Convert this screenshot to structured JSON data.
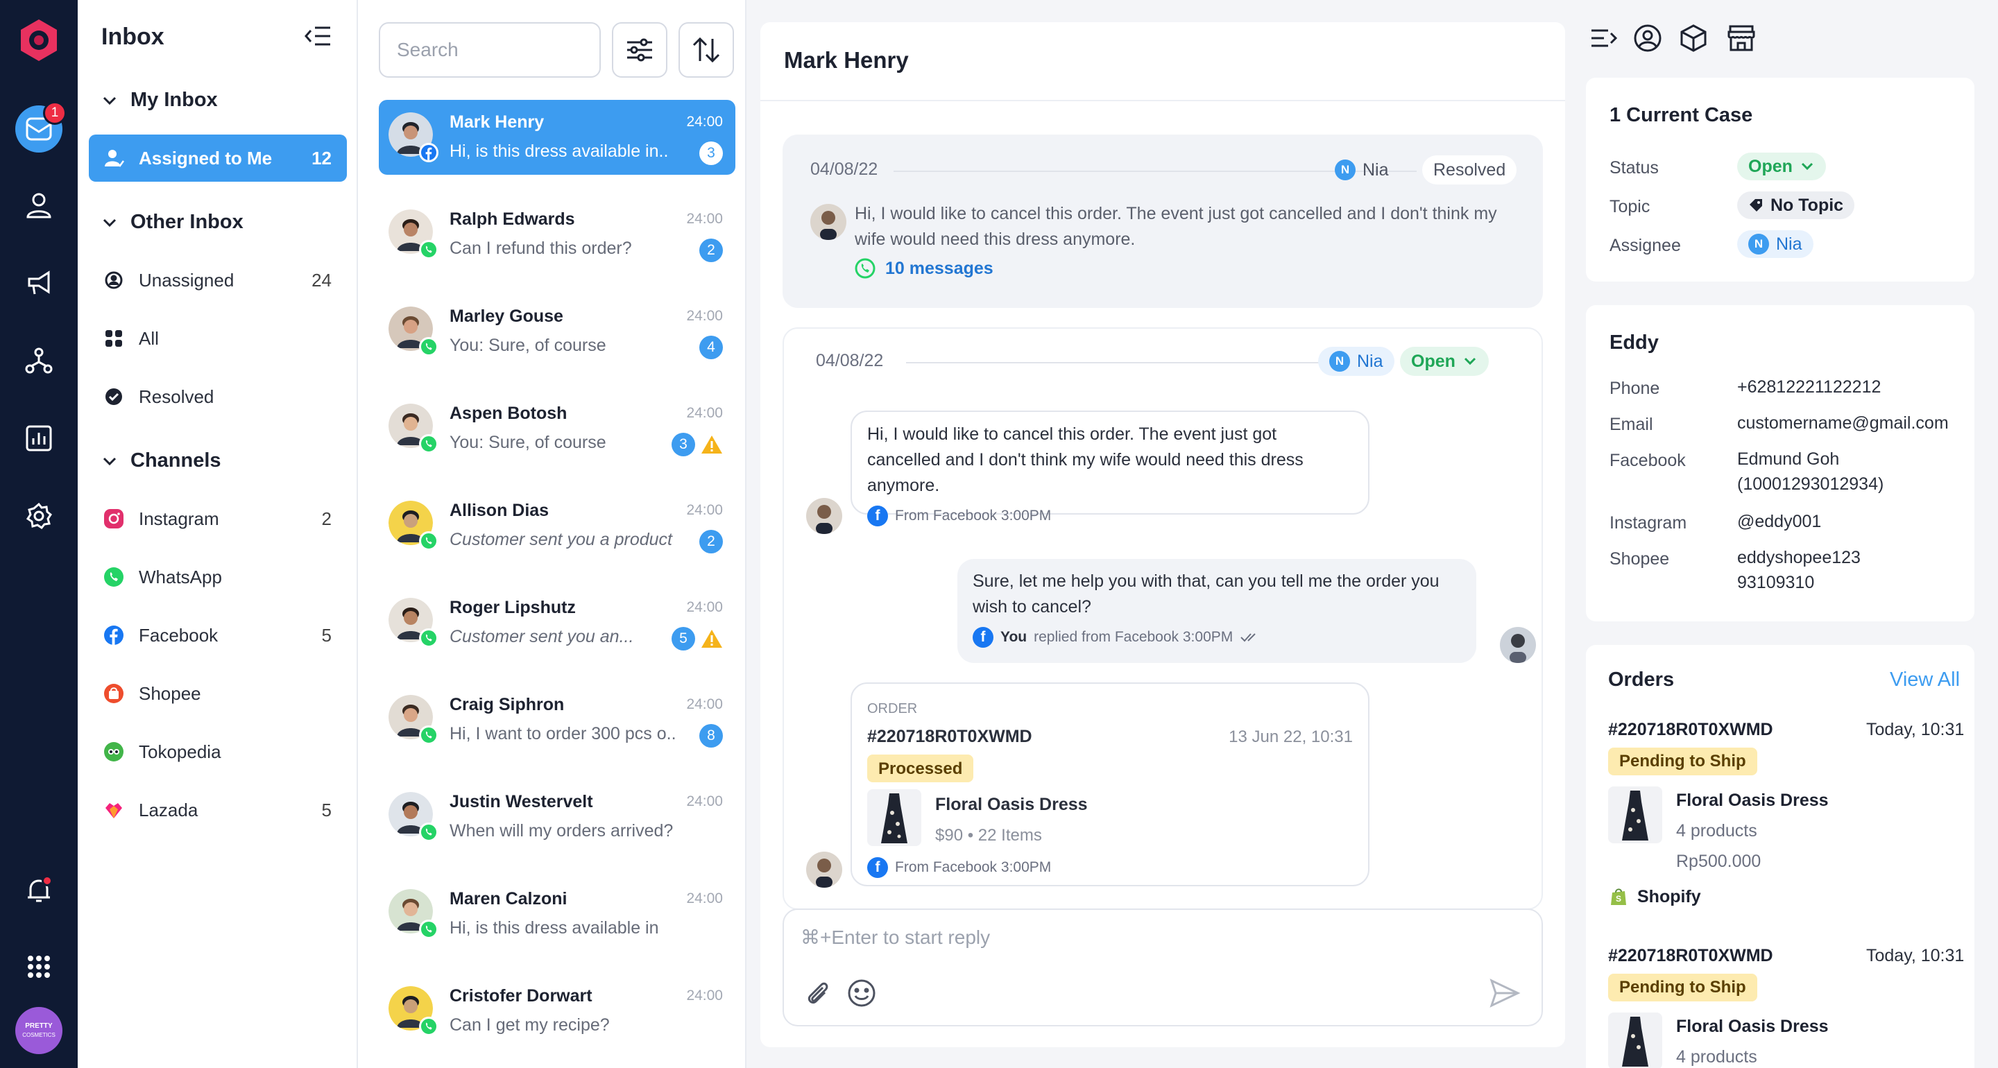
{
  "app": {
    "colors": {
      "accent": "#3d9cf0",
      "rail": "#0f1a33",
      "open": "#1fa657",
      "badge": "#ee2d44"
    }
  },
  "rail": {
    "logo": "logo-icon",
    "inbox_badge": "1",
    "brand_avatar": "PRETTY COSMETICS"
  },
  "sidebar": {
    "title": "Inbox",
    "my_inbox": "My Inbox",
    "assigned": {
      "label": "Assigned to Me",
      "count": "12"
    },
    "other_inbox": "Other Inbox",
    "other": [
      {
        "label": "Unassigned",
        "count": "24"
      },
      {
        "label": "All",
        "count": ""
      },
      {
        "label": "Resolved",
        "count": ""
      }
    ],
    "channels_title": "Channels",
    "channels": [
      {
        "label": "Instagram",
        "count": "2"
      },
      {
        "label": "WhatsApp",
        "count": ""
      },
      {
        "label": "Facebook",
        "count": "5"
      },
      {
        "label": "Shopee",
        "count": ""
      },
      {
        "label": "Tokopedia",
        "count": ""
      },
      {
        "label": "Lazada",
        "count": "5"
      }
    ]
  },
  "convlist": {
    "search_placeholder": "Search",
    "items": [
      {
        "name": "Mark Henry",
        "preview": "Hi, is this dress available in..",
        "time": "24:00",
        "count": "3"
      },
      {
        "name": "Ralph Edwards",
        "preview": "Can I refund this order?",
        "time": "24:00",
        "count": "2"
      },
      {
        "name": "Marley Gouse",
        "preview": "You: Sure, of course",
        "time": "24:00",
        "count": "4"
      },
      {
        "name": "Aspen Botosh",
        "preview": "You: Sure, of course",
        "time": "24:00",
        "count": "3"
      },
      {
        "name": "Allison Dias",
        "preview": "Customer sent you a product",
        "time": "24:00",
        "count": "2"
      },
      {
        "name": "Roger Lipshutz",
        "preview": "Customer sent you an...",
        "time": "24:00",
        "count": "5"
      },
      {
        "name": "Craig Siphron",
        "preview": "Hi, I want to order 300 pcs o..",
        "time": "24:00",
        "count": "8"
      },
      {
        "name": "Justin Westervelt",
        "preview": "When will my orders arrived?",
        "time": "24:00",
        "count": ""
      },
      {
        "name": "Maren Calzoni",
        "preview": "Hi, is this dress available in",
        "time": "24:00",
        "count": ""
      },
      {
        "name": "Cristofer Dorwart",
        "preview": "Can I get my recipe?",
        "time": "24:00",
        "count": ""
      }
    ]
  },
  "chat": {
    "contact": "Mark Henry",
    "case1": {
      "date": "04/08/22",
      "agent": "Nia",
      "status": "Resolved",
      "message": "Hi, I would like to cancel this order. The event just got cancelled and I don't think my wife would need this dress anymore.",
      "messages_link": "10 messages"
    },
    "case2": {
      "date": "04/08/22",
      "agent": "Nia",
      "status": "Open",
      "msg1": {
        "text": "Hi, I would like to cancel this order. The event just got cancelled and I don't think my wife would need this dress anymore.",
        "meta": "From Facebook 3:00PM"
      },
      "msg2": {
        "text": "Sure, let me help you with that, can you tell me the order you wish to cancel?",
        "you": "You",
        "meta": "replied from Facebook 3:00PM"
      },
      "order": {
        "label": "ORDER",
        "id": "#220718R0T0XWMD",
        "date": "13 Jun 22, 10:31",
        "status": "Processed",
        "product": "Floral Oasis Dress",
        "price": "$90 • 22 Items",
        "meta": "From Facebook 3:00PM"
      }
    },
    "reply_placeholder": "⌘+Enter to start reply"
  },
  "panel": {
    "case_title": "1 Current Case",
    "status_label": "Status",
    "status": "Open",
    "topic_label": "Topic",
    "topic": "No Topic",
    "assignee_label": "Assignee",
    "assignee": "Nia",
    "customer": "Eddy",
    "fields": [
      {
        "label": "Phone",
        "value": "+62812221122212"
      },
      {
        "label": "Email",
        "value": "customername@gmail.com"
      },
      {
        "label": "Facebook",
        "value": "Edmund Goh",
        "value2": "(10001293012934)"
      },
      {
        "label": "Instagram",
        "value": "@eddy001"
      },
      {
        "label": "Shopee",
        "value": "eddyshopee123",
        "value2": "93109310"
      }
    ],
    "orders_title": "Orders",
    "view_all": "View All",
    "orders": [
      {
        "id": "#220718R0T0XWMD",
        "time": "Today, 10:31",
        "status": "Pending to Ship",
        "product": "Floral Oasis Dress",
        "qty": "4 products",
        "price": "Rp500.000",
        "store": "Shopify"
      },
      {
        "id": "#220718R0T0XWMD",
        "time": "Today, 10:31",
        "status": "Pending to Ship",
        "product": "Floral Oasis Dress",
        "qty": "4 products"
      }
    ]
  }
}
